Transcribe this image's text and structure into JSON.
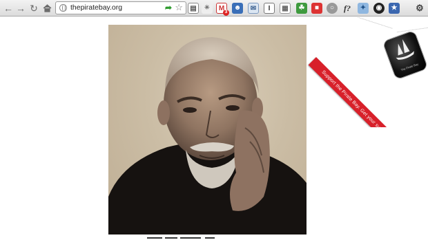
{
  "browser": {
    "url": "thepiratebay.org",
    "mail_badge": "3",
    "ext_label_f": "f?"
  },
  "banner": {
    "ribbon_text": "Support the Pirate Bay. Get your supporter wear here!",
    "tag_text": "The Pirate Bay"
  },
  "colors": {
    "ribbon": "#d8202a",
    "photo_bg": "#c9bba3"
  }
}
